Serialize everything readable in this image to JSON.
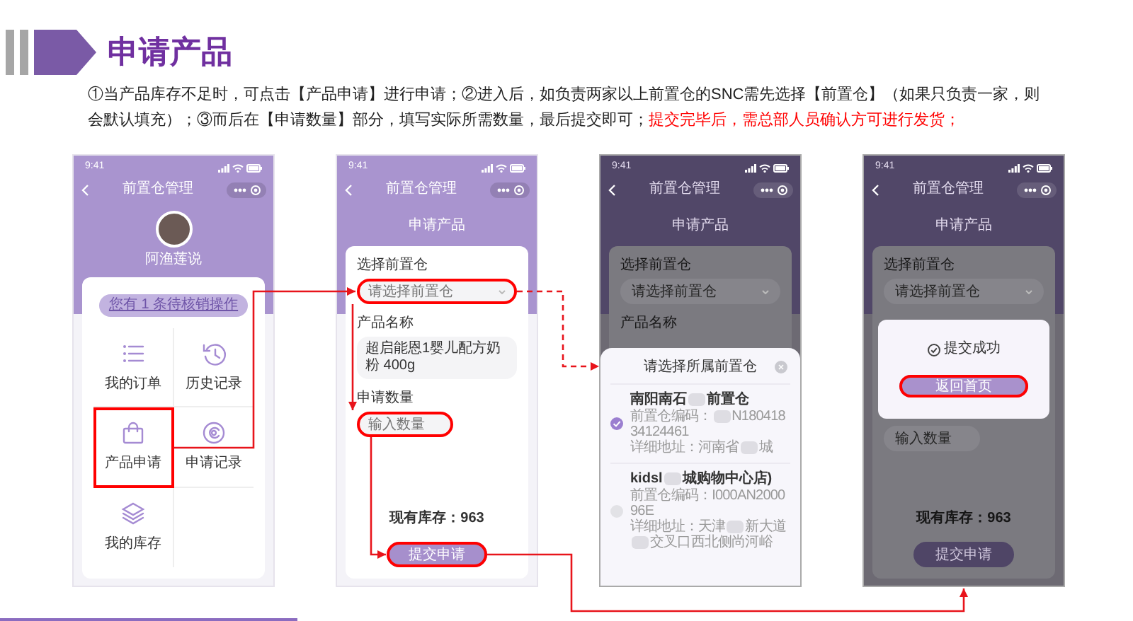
{
  "header": {
    "title": "申请产品"
  },
  "instructions": {
    "text": "①当产品库存不足时，可点击【产品申请】进行申请；②进入后，如负责两家以上前置仓的SNC需先选择【前置仓】（如果只负责一家，则会默认填充）；③而后在【申请数量】部分，填写实际所需数量，最后提交即可；",
    "warning": "提交完毕后，需总部人员确认方可进行发货；"
  },
  "screens": [
    {
      "kind": "home",
      "status_time": "9:41",
      "nav_title": "前置仓管理",
      "dimmed": false,
      "user_name": "阿渔莲说",
      "notice": "您有 1 条待核销操作",
      "menu": [
        {
          "label": "我的订单",
          "highlighted": false
        },
        {
          "label": "历史记录",
          "highlighted": false
        },
        {
          "label": "产品申请",
          "highlighted": true
        },
        {
          "label": "申请记录",
          "highlighted": false
        },
        {
          "label": "我的库存",
          "highlighted": false
        }
      ]
    },
    {
      "kind": "form",
      "status_time": "9:41",
      "nav_title": "前置仓管理",
      "page_title": "申请产品",
      "dimmed": false,
      "form": {
        "warehouse_label": "选择前置仓",
        "warehouse_placeholder": "请选择前置仓",
        "warehouse_highlighted": true,
        "product_label": "产品名称",
        "product_value": "超启能恩1婴儿配方奶粉 400g",
        "quantity_label": "申请数量",
        "quantity_placeholder": "输入数量",
        "quantity_highlighted": true,
        "stock": "现有库存：963",
        "submit": "提交申请",
        "submit_highlighted": true
      }
    },
    {
      "kind": "picker",
      "status_time": "9:41",
      "nav_title": "前置仓管理",
      "page_title": "申请产品",
      "dimmed": true,
      "form": {
        "warehouse_label": "选择前置仓",
        "warehouse_placeholder": "请选择前置仓",
        "warehouse_highlighted": false,
        "product_label": "产品名称"
      },
      "sheet": {
        "title": "请选择所属前置仓",
        "options": [
          {
            "name": [
              "南阳南石",
              "前置仓"
            ],
            "code": [
              "前置仓编码：",
              "N18041834124461"
            ],
            "address": [
              "详细地址：河南省",
              "城"
            ],
            "selected": true
          },
          {
            "name": [
              "kidsl",
              "城购物中心店)"
            ],
            "code": [
              "前置仓编码：I000AN200096E"
            ],
            "address": [
              "详细地址：天津",
              "新大道",
              "交叉口西北侧尚河峪"
            ],
            "selected": false
          }
        ]
      }
    },
    {
      "kind": "success",
      "status_time": "9:41",
      "nav_title": "前置仓管理",
      "page_title": "申请产品",
      "dimmed": true,
      "form": {
        "warehouse_label": "选择前置仓",
        "warehouse_placeholder": "请选择前置仓",
        "warehouse_highlighted": false,
        "quantity_placeholder": "输入数量",
        "stock": "现有库存：963",
        "submit": "提交申请",
        "submit_highlighted": false
      },
      "dialog": {
        "message": "提交成功",
        "button": "返回首页",
        "button_highlighted": true
      }
    }
  ]
}
